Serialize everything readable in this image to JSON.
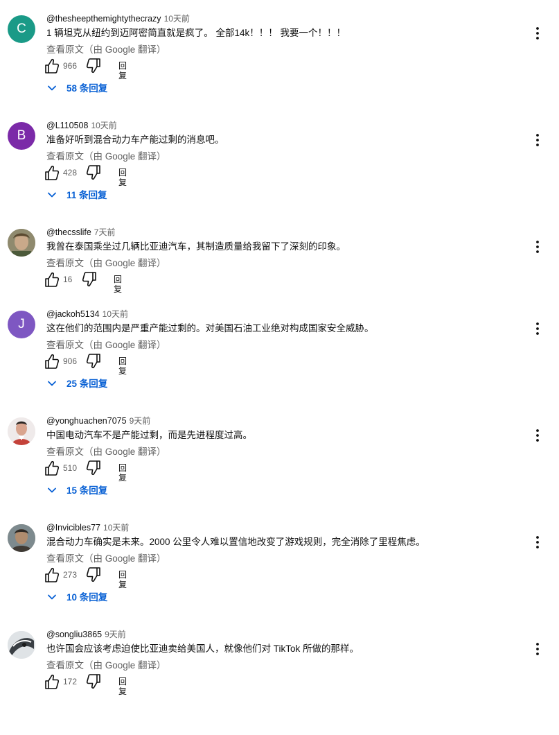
{
  "comments": [
    {
      "author": "@thesheepthemightythecrazy",
      "time": "10天前",
      "text": "1 辆坦克从纽约到迈阿密简直就是疯了。  全部14k！！！  我要一个！！！",
      "translate": "查看原文（由 Google 翻译）",
      "likes": "966",
      "reply": "回复",
      "replies": "58 条回复",
      "avatar_letter": "C",
      "avatar_color": "#1a9a87"
    },
    {
      "author": "@L110508",
      "time": "10天前",
      "text": "准备好听到混合动力车产能过剩的消息吧。",
      "translate": "查看原文（由 Google 翻译）",
      "likes": "428",
      "reply": "回复",
      "replies": "11 条回复",
      "avatar_letter": "B",
      "avatar_color": "#7b2aa8"
    },
    {
      "author": "@thecsslife",
      "time": "7天前",
      "text": "我曾在泰国乘坐过几辆比亚迪汽车，其制造质量给我留下了深刻的印象。",
      "translate": "查看原文（由 Google 翻译）",
      "likes": "16",
      "reply": "回复",
      "replies": "",
      "avatar_letter": "",
      "avatar_color": "#7a7a60"
    },
    {
      "author": "@jackoh5134",
      "time": "10天前",
      "text": "这在他们的范围内是严重产能过剩的。对美国石油工业绝对构成国家安全威胁。",
      "translate": "查看原文（由 Google 翻译）",
      "likes": "906",
      "reply": "回复",
      "replies": "25 条回复",
      "avatar_letter": "J",
      "avatar_color": "#7e57c2"
    },
    {
      "author": "@yonghuachen7075",
      "time": "9天前",
      "text": "中国电动汽车不是产能过剩，而是先进程度过高。",
      "translate": "查看原文（由 Google 翻译）",
      "likes": "510",
      "reply": "回复",
      "replies": "15 条回复",
      "avatar_letter": "",
      "avatar_color": "#e8e2df"
    },
    {
      "author": "@Invicibles77",
      "time": "10天前",
      "text": "混合动力车确实是未来。2000 公里令人难以置信地改变了游戏规则，完全消除了里程焦虑。",
      "translate": "查看原文（由 Google 翻译）",
      "likes": "273",
      "reply": "回复",
      "replies": "10 条回复",
      "avatar_letter": "",
      "avatar_color": "#6d6a5e"
    },
    {
      "author": "@songliu3865",
      "time": "9天前",
      "text": "也许国会应该考虑迫使比亚迪卖给美国人，就像他们对 TikTok 所做的那样。",
      "translate": "查看原文（由 Google 翻译）",
      "likes": "172",
      "reply": "回复",
      "replies": "",
      "avatar_letter": "",
      "avatar_color": "#cfd3d6"
    }
  ],
  "colors": {
    "link": "#065fd4",
    "secondary": "#606060",
    "primary": "#0f0f0f"
  },
  "icons": {
    "like": "thumb-up-icon",
    "dislike": "thumb-down-icon",
    "expand": "chevron-down-icon",
    "menu": "more-vert-icon"
  }
}
